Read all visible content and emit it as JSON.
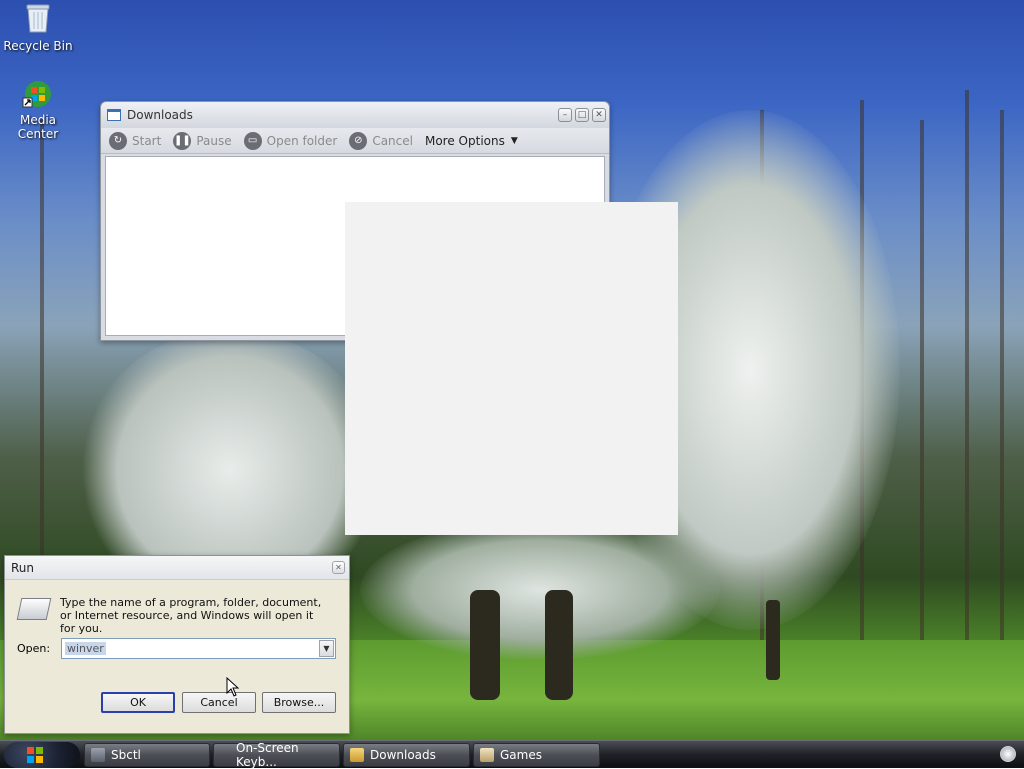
{
  "desktop": {
    "icons": [
      {
        "label": "Recycle Bin",
        "icon": "recycle-bin-icon"
      },
      {
        "label": "Media Center",
        "icon": "media-center-icon"
      }
    ]
  },
  "downloads_window": {
    "title": "Downloads",
    "toolbar": {
      "start": "Start",
      "pause": "Pause",
      "open_folder": "Open folder",
      "cancel": "Cancel",
      "more_options": "More Options"
    }
  },
  "run_dialog": {
    "title": "Run",
    "description": "Type the name of a program, folder, document, or Internet resource, and Windows will open it for you.",
    "open_label": "Open:",
    "open_value": "winver",
    "ok": "OK",
    "cancel": "Cancel",
    "browse": "Browse..."
  },
  "taskbar": {
    "items": [
      {
        "label": "Sbctl",
        "icon": "sbctl-icon"
      },
      {
        "label": "On-Screen Keyb...",
        "icon": ""
      },
      {
        "label": "Downloads",
        "icon": "folder-icon"
      },
      {
        "label": "Games",
        "icon": "games-icon"
      }
    ]
  },
  "colors": {
    "taskbar": "#1e2126",
    "dialog_bg": "#ece9d8",
    "selection": "#c8d6ec"
  }
}
